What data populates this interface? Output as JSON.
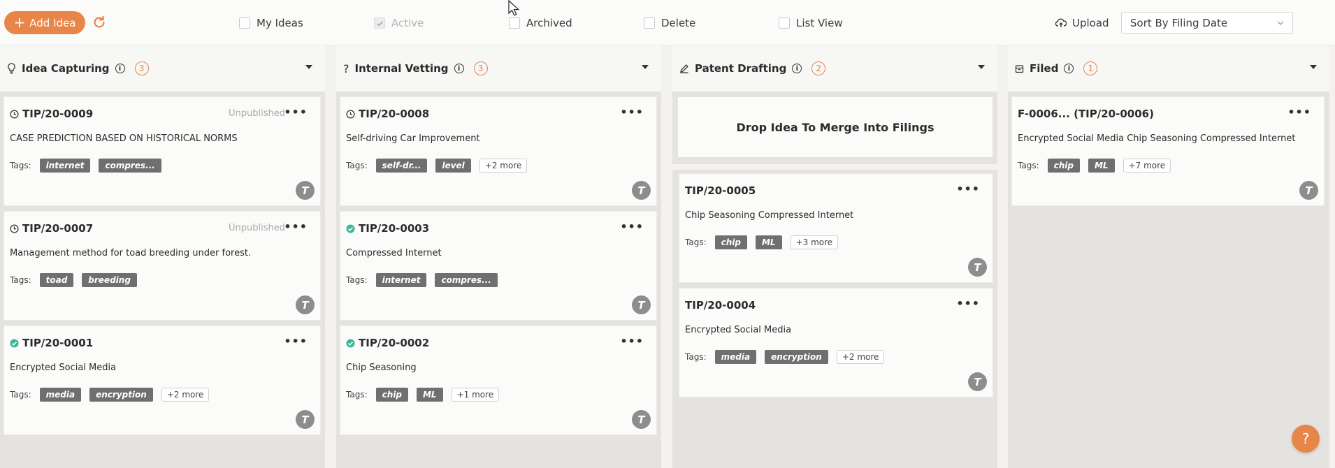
{
  "toolbar": {
    "add_label": "Add Idea",
    "filters": {
      "my_ideas": "My Ideas",
      "active": "Active",
      "archived": "Archived",
      "delete": "Delete",
      "list_view": "List View"
    },
    "upload_label": "Upload",
    "sort_value": "Sort By Filing Date"
  },
  "columns": {
    "capture": {
      "title": "Idea Capturing",
      "count": "3",
      "cards": [
        {
          "id": "TIP/20-0009",
          "status": "Unpublished",
          "desc": "CASE PREDICTION BASED ON HISTORICAL NORMS",
          "tags_label": "Tags:",
          "tags": [
            "internet",
            "compres..."
          ],
          "more": "",
          "avatar": "T"
        },
        {
          "id": "TIP/20-0007",
          "status": "Unpublished",
          "desc": "Management method for toad breeding under forest.",
          "tags_label": "Tags:",
          "tags": [
            "toad",
            "breeding"
          ],
          "more": "",
          "avatar": "T"
        },
        {
          "id": "TIP/20-0001",
          "status": "",
          "desc": "Encrypted Social Media",
          "tags_label": "Tags:",
          "tags": [
            "media",
            "encryption"
          ],
          "more": "+2 more",
          "avatar": "T"
        }
      ]
    },
    "vetting": {
      "title": "Internal Vetting",
      "count": "3",
      "cards": [
        {
          "id": "TIP/20-0008",
          "desc": "Self-driving Car Improvement",
          "tags_label": "Tags:",
          "tags": [
            "self-dr...",
            "level"
          ],
          "more": "+2 more",
          "avatar": "T"
        },
        {
          "id": "TIP/20-0003",
          "desc": "Compressed Internet",
          "tags_label": "Tags:",
          "tags": [
            "internet",
            "compres..."
          ],
          "more": "",
          "avatar": "T"
        },
        {
          "id": "TIP/20-0002",
          "desc": "Chip Seasoning",
          "tags_label": "Tags:",
          "tags": [
            "chip",
            "ML"
          ],
          "more": "+1 more",
          "avatar": "T"
        }
      ]
    },
    "drafting": {
      "title": "Patent Drafting",
      "count": "2",
      "drop_text": "Drop Idea To Merge Into Filings",
      "cards": [
        {
          "id": "TIP/20-0005",
          "desc": "Chip Seasoning Compressed Internet",
          "tags_label": "Tags:",
          "tags": [
            "chip",
            "ML"
          ],
          "more": "+3 more",
          "avatar": "T"
        },
        {
          "id": "TIP/20-0004",
          "desc": "Encrypted Social Media",
          "tags_label": "Tags:",
          "tags": [
            "media",
            "encryption"
          ],
          "more": "+2 more",
          "avatar": "T"
        }
      ]
    },
    "filed": {
      "title": "Filed",
      "count": "1",
      "cards": [
        {
          "id": "F-0006... (TIP/20-0006)",
          "desc": "Encrypted Social Media Chip Seasoning Compressed Internet",
          "tags_label": "Tags:",
          "tags": [
            "chip",
            "ML"
          ],
          "more": "+7 more",
          "avatar": "T"
        }
      ]
    }
  },
  "help_label": "?",
  "colors": {
    "accent": "#e8864a",
    "verified": "#3fb59a",
    "tag": "#6f6f6f"
  }
}
